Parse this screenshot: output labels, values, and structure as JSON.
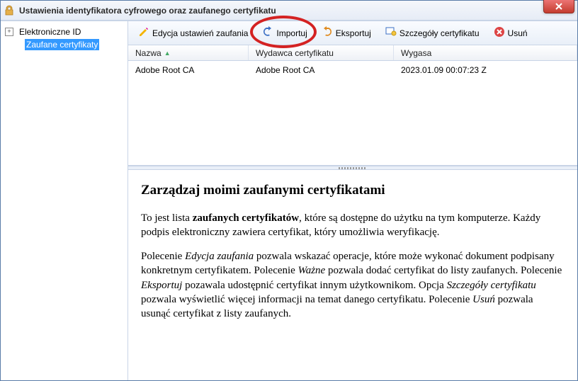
{
  "window": {
    "title": "Ustawienia identyfikatora cyfrowego oraz zaufanego certyfikatu"
  },
  "sidebar": {
    "root": "Elektroniczne ID",
    "child": "Zaufane certyfikaty"
  },
  "toolbar": {
    "edit": "Edycja ustawień zaufania",
    "import": "Importuj",
    "export": "Eksportuj",
    "details": "Szczegóły certyfikatu",
    "delete": "Usuń"
  },
  "table": {
    "headers": {
      "name": "Nazwa",
      "issuer": "Wydawca certyfikatu",
      "expires": "Wygasa"
    },
    "rows": [
      {
        "name": "Adobe Root CA",
        "issuer": "Adobe Root CA",
        "expires": "2023.01.09 00:07:23 Z"
      }
    ]
  },
  "detail": {
    "heading": "Zarządzaj moimi zaufanymi certyfikatami",
    "p1_a": "To jest lista ",
    "p1_b": "zaufanych certyfikatów",
    "p1_c": ", które są dostępne do użytku na tym komputerze. Każdy podpis elektroniczny zawiera certyfikat, który umożliwia weryfikację.",
    "p2_a": "Polecenie ",
    "p2_b": "Edycja zaufania",
    "p2_c": " pozwala wskazać operacje, które może wykonać dokument podpisany konkretnym certyfikatem. Polecenie ",
    "p2_d": "Ważne",
    "p2_e": " pozwala dodać certyfikat do listy zaufanych. Polecenie ",
    "p2_f": "Eksportuj",
    "p2_g": " pozawala udostępnić certyfikat innym użytkownikom. Opcja ",
    "p2_h": "Szczegóły certyfikatu",
    "p2_i": " pozwala wyświetlić więcej informacji na temat danego certyfikatu. Polecenie ",
    "p2_j": "Usuń",
    "p2_k": " pozwala usunąć certyfikat z listy zaufanych."
  }
}
